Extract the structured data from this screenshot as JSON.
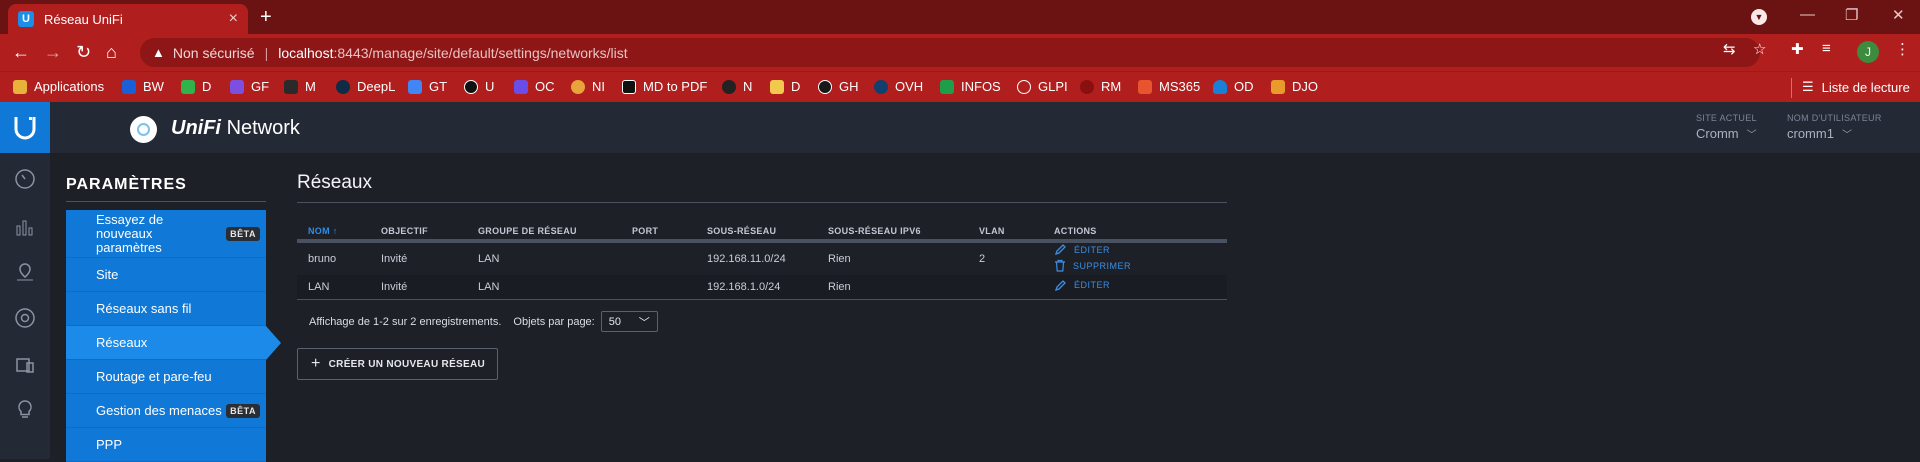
{
  "browser": {
    "tab_title": "Réseau UniFi",
    "tab_favicon": "U",
    "new_tab": "+",
    "tab_close": "×",
    "security_label": "Non sécurisé",
    "url_host": "localhost",
    "url_path": ":8443/manage/site/default/settings/networks/list",
    "avatar_letter": "J",
    "window_controls": [
      "—",
      "❐",
      "✕"
    ],
    "bookmarks": [
      {
        "label": "Applications",
        "color": "#e8b13a"
      },
      {
        "label": "BW",
        "color": "#1a5fd6"
      },
      {
        "label": "D",
        "color": "#2fb34a"
      },
      {
        "label": "GF",
        "color": "#7b4fe0"
      },
      {
        "label": "M",
        "color": "#2a2a2a"
      },
      {
        "label": "DeepL",
        "color": "#0f2b46"
      },
      {
        "label": "GT",
        "color": "#4285f4"
      },
      {
        "label": "U",
        "color": "#111111"
      },
      {
        "label": "OC",
        "color": "#6a4de8"
      },
      {
        "label": "NI",
        "color": "#e8a33a"
      },
      {
        "label": "MD to PDF",
        "color": "#111111"
      },
      {
        "label": "N",
        "color": "#222222"
      },
      {
        "label": "D",
        "color": "#f2c94c"
      },
      {
        "label": "GH",
        "color": "#181818"
      },
      {
        "label": "OVH",
        "color": "#123f6d"
      },
      {
        "label": "INFOS",
        "color": "#1e9e4a"
      },
      {
        "label": "GLPI",
        "color": "#b01e1e"
      },
      {
        "label": "RM",
        "color": "#8a1010"
      },
      {
        "label": "MS365",
        "color": "#e8542e"
      },
      {
        "label": "OD",
        "color": "#1a7fd6"
      },
      {
        "label": "DJO",
        "color": "#e89a2a"
      }
    ],
    "reading_list": "Liste de lecture"
  },
  "app": {
    "brand_prefix": "UniFi",
    "brand_suffix": "Network",
    "site_caption": "SITE ACTUEL",
    "site_value": "Cromm",
    "user_caption": "NOM D'UTILISATEUR",
    "user_value": "cromm1"
  },
  "rail_icons": [
    "dashboard-icon",
    "statistics-icon",
    "map-icon",
    "devices-icon",
    "clients-icon",
    "insights-icon"
  ],
  "settings": {
    "title": "PARAMÈTRES",
    "menu": [
      {
        "label": "Essayez de nouveaux paramètres",
        "badge": "BÊTA"
      },
      {
        "label": "Site",
        "badge": ""
      },
      {
        "label": "Réseaux sans fil",
        "badge": ""
      },
      {
        "label": "Réseaux",
        "badge": ""
      },
      {
        "label": "Routage et pare-feu",
        "badge": ""
      },
      {
        "label": "Gestion des menaces",
        "badge": "BÊTA"
      },
      {
        "label": "PPP",
        "badge": ""
      }
    ],
    "active_index": 3
  },
  "networks": {
    "title": "Réseaux",
    "columns": [
      "NOM",
      "OBJECTIF",
      "GROUPE DE RÉSEAU",
      "PORT",
      "SOUS-RÉSEAU",
      "SOUS-RÉSEAU IPV6",
      "VLAN",
      "ACTIONS"
    ],
    "sort_indicator": "↑",
    "rows": [
      {
        "name": "bruno",
        "purpose": "Invité",
        "group": "LAN",
        "port": "",
        "subnet": "192.168.11.0/24",
        "ipv6": "Rien",
        "vlan": "2",
        "edit": "ÉDITER",
        "delete": "SUPPRIMER"
      },
      {
        "name": "LAN",
        "purpose": "Invité",
        "group": "LAN",
        "port": "",
        "subnet": "192.168.1.0/24",
        "ipv6": "Rien",
        "vlan": "",
        "edit": "ÉDITER",
        "delete": ""
      }
    ],
    "record_info": "Affichage de 1-2 sur 2 enregistrements.",
    "per_page_label": "Objets par page:",
    "per_page_value": "50",
    "create_button": "CRÉER UN NOUVEAU RÉSEAU"
  }
}
